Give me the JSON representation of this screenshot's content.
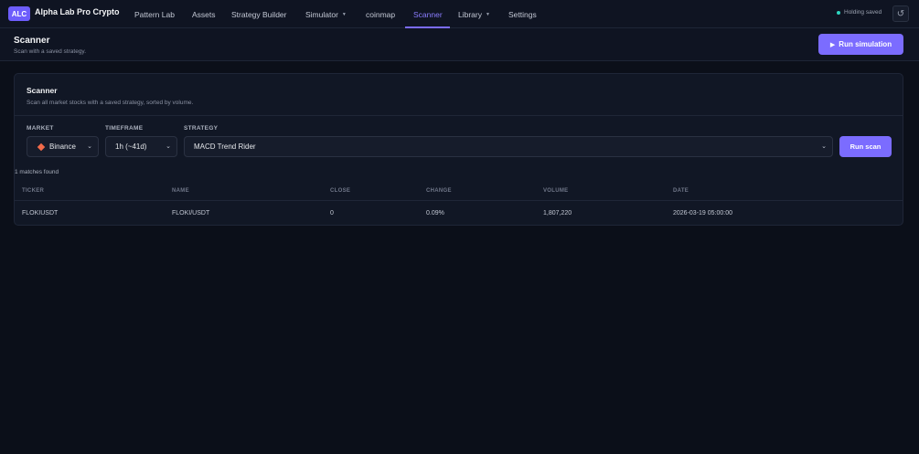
{
  "app": {
    "logo_badge": "ALC",
    "name": "Alpha Lab Pro Crypto"
  },
  "nav": {
    "items": [
      {
        "label": "Pattern Lab"
      },
      {
        "label": "Assets"
      },
      {
        "label": "Strategy Builder"
      },
      {
        "label": "Simulator",
        "has_dropdown": true
      },
      {
        "label": "coinmap"
      },
      {
        "label": "Scanner",
        "active": true
      },
      {
        "label": "Library",
        "has_dropdown": true
      },
      {
        "label": "Settings"
      }
    ],
    "status_text": "Holding saved",
    "status_color": "#2dd4bf",
    "refresh_icon": "refresh-icon"
  },
  "header": {
    "title": "Scanner",
    "subtitle": "Scan with a saved strategy.",
    "run_simulation_label": "Run simulation"
  },
  "card": {
    "title": "Scanner",
    "description": "Scan all market stocks with a saved strategy, sorted by volume.",
    "fields": {
      "market_label": "MARKET",
      "market_value": "Binance",
      "timeframe_label": "TIMEFRAME",
      "timeframe_value": "1h (~41d)",
      "strategy_label": "STRATEGY",
      "strategy_value": "MACD Trend Rider"
    },
    "run_scan_label": "Run scan",
    "matches_text": "1 matches found",
    "table": {
      "headers": {
        "ticker": "TICKER",
        "name": "NAME",
        "close": "CLOSE",
        "change": "CHANGE",
        "volume": "VOLUME",
        "date": "DATE"
      },
      "rows": [
        {
          "ticker": "FLOKIUSDT",
          "name": "FLOKI/USDT",
          "close": "0",
          "change": "0.09%",
          "volume": "1,807,220",
          "date": "2026-03-19 05:00:00"
        }
      ]
    }
  },
  "colors": {
    "accent": "#7b6cff",
    "background": "#0b0f19",
    "binance_icon": "#f26b4a"
  }
}
